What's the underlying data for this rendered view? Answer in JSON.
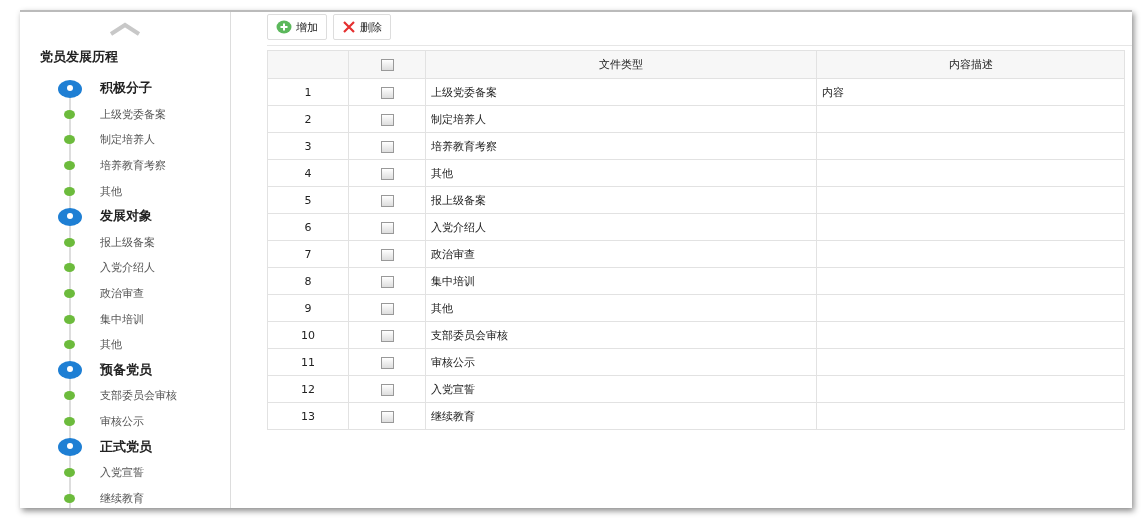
{
  "sidebar": {
    "title": "党员发展历程",
    "groups": [
      {
        "label": "积极分子",
        "children": [
          {
            "label": "上级党委备案"
          },
          {
            "label": "制定培养人"
          },
          {
            "label": "培养教育考察"
          },
          {
            "label": "其他"
          }
        ]
      },
      {
        "label": "发展对象",
        "children": [
          {
            "label": "报上级备案"
          },
          {
            "label": "入党介绍人"
          },
          {
            "label": "政治审查"
          },
          {
            "label": "集中培训"
          },
          {
            "label": "其他"
          }
        ]
      },
      {
        "label": "预备党员",
        "children": [
          {
            "label": "支部委员会审核"
          },
          {
            "label": "审核公示"
          }
        ]
      },
      {
        "label": "正式党员",
        "children": [
          {
            "label": "入党宣誓"
          },
          {
            "label": "继续教育"
          }
        ]
      }
    ]
  },
  "toolbar": [
    {
      "label": "增加",
      "kind": "add"
    },
    {
      "label": "删除",
      "kind": "delete"
    }
  ],
  "table": {
    "columns": [
      {
        "kind": "index"
      },
      {
        "kind": "checkbox",
        "checked": false
      },
      {
        "kind": "text",
        "label": "文件类型"
      },
      {
        "kind": "text",
        "label": "内容描述"
      }
    ],
    "rows": [
      {
        "index": "1",
        "checked": false,
        "type": "上级党委备案",
        "description": "内容"
      },
      {
        "index": "2",
        "checked": false,
        "type": "制定培养人"
      },
      {
        "index": "3",
        "checked": false,
        "type": "培养教育考察"
      },
      {
        "index": "4",
        "checked": false,
        "type": "其他"
      },
      {
        "index": "5",
        "checked": false,
        "type": "报上级备案"
      },
      {
        "index": "6",
        "checked": false,
        "type": "入党介绍人"
      },
      {
        "index": "7",
        "checked": false,
        "type": "政治审查"
      },
      {
        "index": "8",
        "checked": false,
        "type": "集中培训"
      },
      {
        "index": "9",
        "checked": false,
        "type": "其他"
      },
      {
        "index": "10",
        "checked": false,
        "type": "支部委员会审核"
      },
      {
        "index": "11",
        "checked": false,
        "type": "审核公示"
      },
      {
        "index": "12",
        "checked": false,
        "type": "入党宣誓"
      },
      {
        "index": "13",
        "checked": false,
        "type": "继续教育"
      }
    ]
  }
}
